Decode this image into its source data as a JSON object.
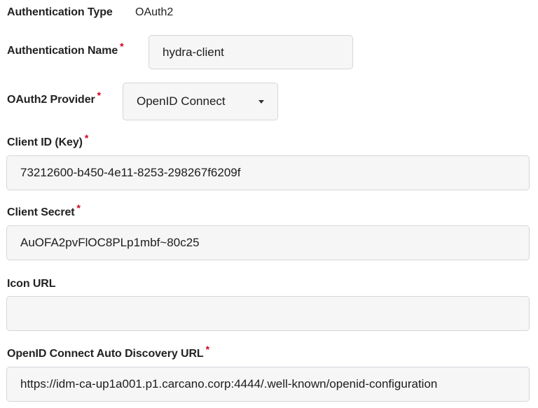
{
  "auth_type": {
    "label": "Authentication Type",
    "value": "OAuth2"
  },
  "auth_name": {
    "label": "Authentication Name",
    "required_mark": "*",
    "value": "hydra-client"
  },
  "oauth2_provider": {
    "label": "OAuth2 Provider",
    "required_mark": "*",
    "selected": "OpenID Connect",
    "icon": "chevron-down-icon"
  },
  "client_id": {
    "label": "Client ID (Key)",
    "required_mark": "*",
    "value": "73212600-b450-4e11-8253-298267f6209f"
  },
  "client_secret": {
    "label": "Client Secret",
    "required_mark": "*",
    "value": "AuOFA2pvFlOC8PLp1mbf~80c25"
  },
  "icon_url": {
    "label": "Icon URL",
    "value": ""
  },
  "discovery_url": {
    "label": "OpenID Connect Auto Discovery URL",
    "required_mark": "*",
    "value": "https://idm-ca-up1a001.p1.carcano.corp:4444/.well-known/openid-configuration"
  },
  "colors": {
    "required": "#d0021b",
    "field_bg": "#f6f6f7",
    "field_border": "#d3d6da"
  }
}
